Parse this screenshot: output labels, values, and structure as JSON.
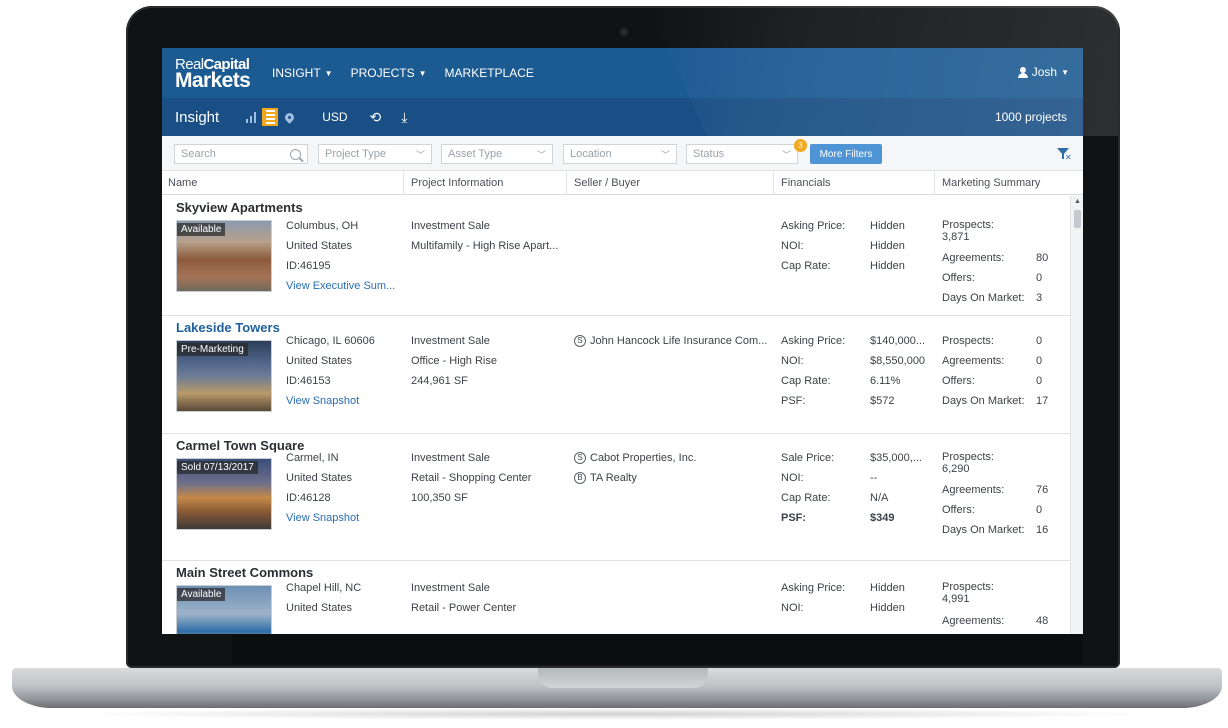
{
  "app": {
    "logo_line1_regular": "Real",
    "logo_line1_bold": "Capital",
    "logo_line2": "Markets",
    "nav": [
      "INSIGHT",
      "PROJECTS",
      "MARKETPLACE"
    ],
    "user": "Josh"
  },
  "subnav": {
    "title": "Insight",
    "currency": "USD",
    "project_count": "1000 projects"
  },
  "filters": {
    "search_placeholder": "Search",
    "project_type": "Project Type",
    "asset_type": "Asset Type",
    "location": "Location",
    "status": "Status",
    "badge_count": "3",
    "more_filters": "More Filters"
  },
  "columns": [
    "Name",
    "Project Information",
    "Seller / Buyer",
    "Financials",
    "Marketing Summary"
  ],
  "rows": [
    {
      "name": "Skyview Apartments",
      "status_tag": "Available",
      "city": "Columbus, OH",
      "country": "United States",
      "id": "ID:46195",
      "link": "View Executive Sum...",
      "info1": "Investment Sale",
      "info2": "Multifamily - High Rise Apart...",
      "info3": "",
      "fin": [
        [
          "Asking Price:",
          "Hidden"
        ],
        [
          "NOI:",
          "Hidden"
        ],
        [
          "Cap Rate:",
          "Hidden"
        ]
      ],
      "mkt_prospects": "3,871",
      "mkt_agreements": "80",
      "mkt_offers": "0",
      "mkt_days": "3"
    },
    {
      "name": "Lakeside Towers",
      "status_tag": "Pre-Marketing",
      "city": "Chicago, IL 60606",
      "country": "United States",
      "id": "ID:46153",
      "link": "View Snapshot",
      "info1": "Investment Sale",
      "info2": "Office - High Rise",
      "info3": "244,961 SF",
      "seller": "John Hancock Life Insurance Com...",
      "fin": [
        [
          "Asking Price:",
          "$140,000..."
        ],
        [
          "NOI:",
          "$8,550,000"
        ],
        [
          "Cap Rate:",
          "6.11%"
        ],
        [
          "PSF:",
          "$572"
        ]
      ],
      "mkt_prospects": "0",
      "mkt_agreements": "0",
      "mkt_offers": "0",
      "mkt_days": "17"
    },
    {
      "name": "Carmel Town Square",
      "status_tag": "Sold  07/13/2017",
      "city": "Carmel, IN",
      "country": "United States",
      "id": "ID:46128",
      "link": "View Snapshot",
      "info1": "Investment Sale",
      "info2": "Retail - Shopping Center",
      "info3": "100,350 SF",
      "seller": "Cabot Properties, Inc.",
      "buyer": "TA Realty",
      "fin": [
        [
          "Sale Price:",
          "$35,000,..."
        ],
        [
          "NOI:",
          "--"
        ],
        [
          "Cap Rate:",
          "N/A"
        ],
        [
          "PSF:",
          "$349"
        ]
      ],
      "mkt_prospects": "6,290",
      "mkt_agreements": "76",
      "mkt_offers": "0",
      "mkt_days": "16"
    },
    {
      "name": "Main Street Commons",
      "status_tag": "Available",
      "city": "Chapel Hill, NC",
      "country": "United States",
      "info1": "Investment Sale",
      "info2": "Retail - Power Center",
      "fin": [
        [
          "Asking Price:",
          "Hidden"
        ],
        [
          "NOI:",
          "Hidden"
        ]
      ],
      "mkt_prospects": "4,991",
      "mkt_agreements": "48"
    }
  ],
  "labels": {
    "prospects": "Prospects:",
    "agreements": "Agreements:",
    "offers": "Offers:",
    "days": "Days On Market:"
  },
  "icons": {
    "seller": "S",
    "buyer": "B"
  },
  "colors": {
    "nav_bg": "#1c5a92",
    "subnav_bg": "#1a4f85",
    "accent": "#f2a81d",
    "button": "#4f95d6",
    "link": "#2a6db3"
  }
}
